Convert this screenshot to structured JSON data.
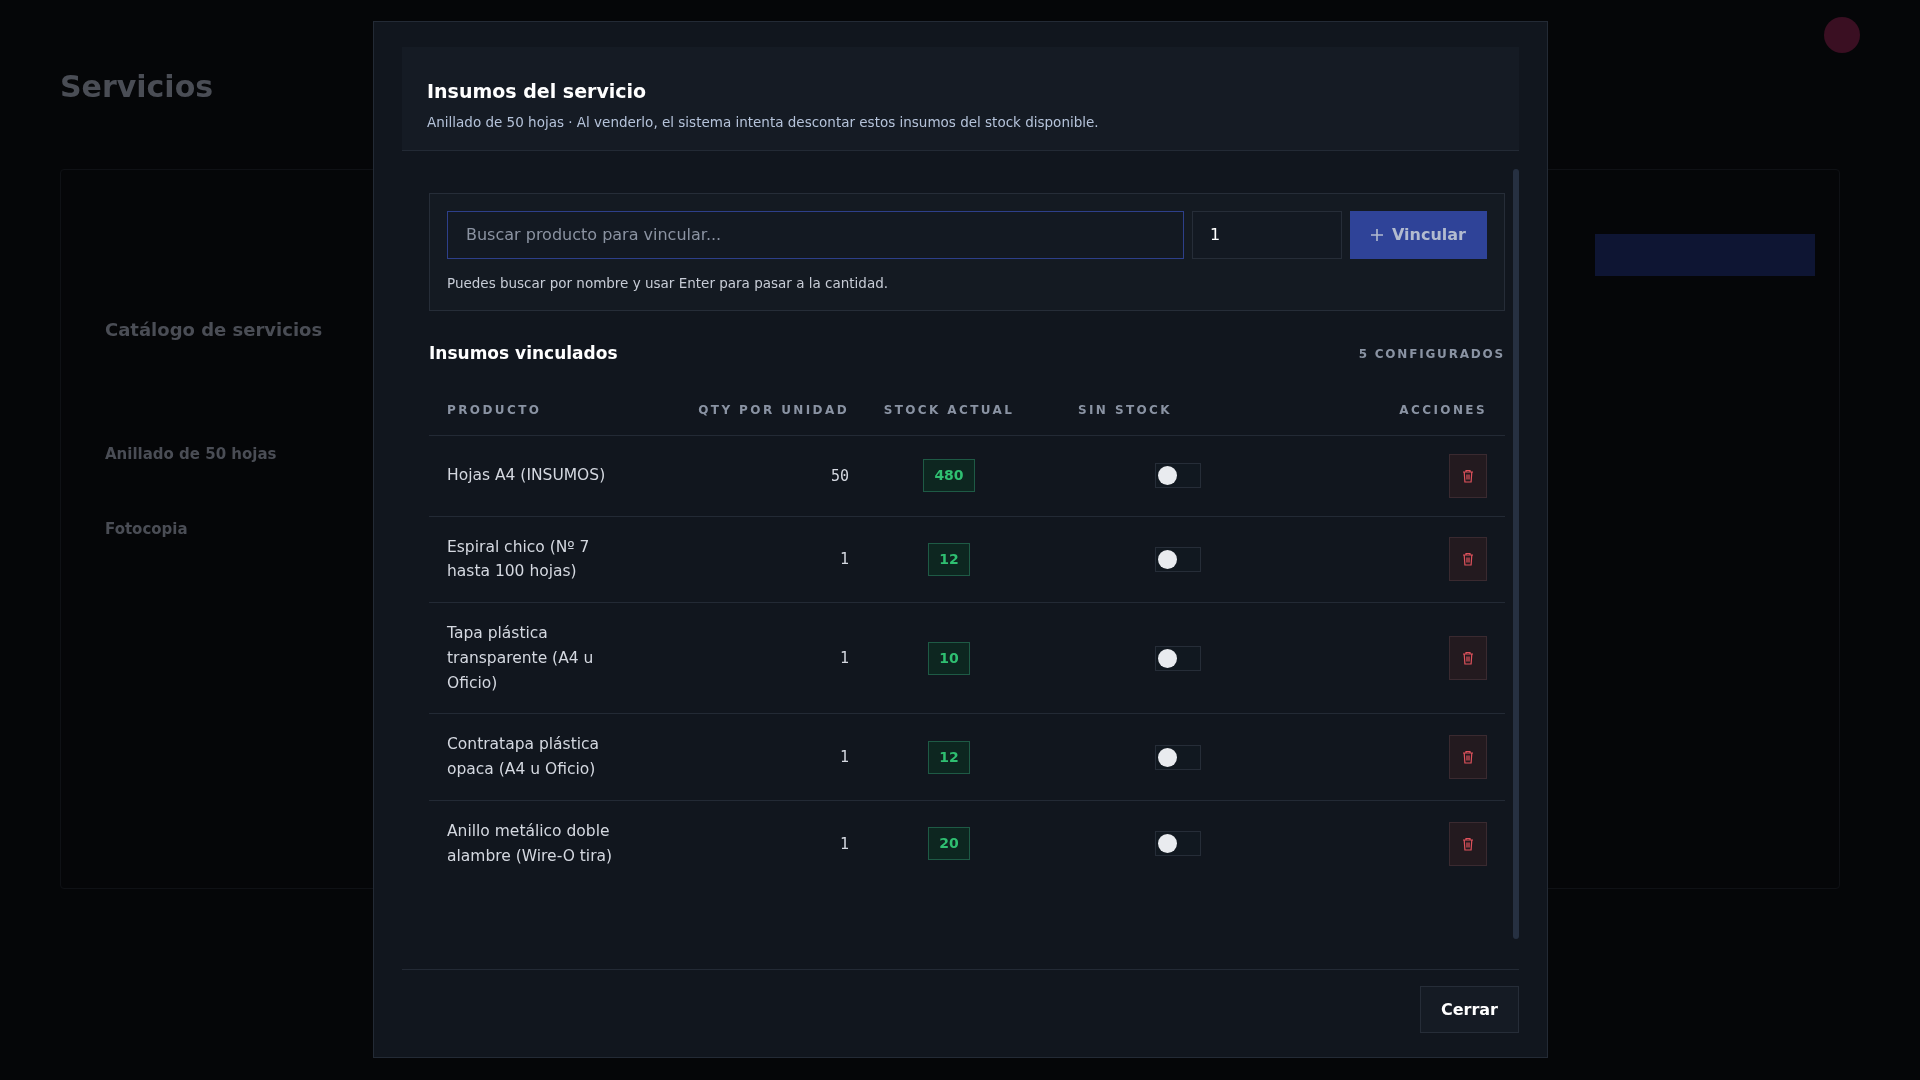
{
  "background": {
    "page_title": "Servicios",
    "section_title": "Catálogo de servicios",
    "services": [
      "Anillado de 50 hojas",
      "Fotocopia"
    ]
  },
  "modal": {
    "title": "Insumos del servicio",
    "subtitle": "Anillado de 50 hojas · Al venderlo, el sistema intenta descontar estos insumos del stock disponible.",
    "search": {
      "placeholder": "Buscar producto para vincular...",
      "quantity": "1",
      "button": "Vincular",
      "hint": "Puedes buscar por nombre y usar Enter para pasar a la cantidad."
    },
    "linked_title": "Insumos vinculados",
    "linked_count": "5 CONFIGURADOS",
    "table": {
      "columns": [
        "PRODUCTO",
        "QTY POR UNIDAD",
        "STOCK ACTUAL",
        "SIN STOCK",
        "ACCIONES"
      ],
      "rows": [
        {
          "product": "Hojas A4 (INSUMOS)",
          "qty": "50",
          "stock": "480",
          "no_stock": false
        },
        {
          "product": "Espiral chico (Nº 7 hasta 100 hojas)",
          "qty": "1",
          "stock": "12",
          "no_stock": false
        },
        {
          "product": "Tapa plástica transparente (A4 u Oficio)",
          "qty": "1",
          "stock": "10",
          "no_stock": false
        },
        {
          "product": "Contratapa plástica opaca (A4 u Oficio)",
          "qty": "1",
          "stock": "12",
          "no_stock": false
        },
        {
          "product": "Anillo metálico doble alambre (Wire-O tira)",
          "qty": "1",
          "stock": "20",
          "no_stock": false
        }
      ]
    },
    "close_button": "Cerrar"
  }
}
